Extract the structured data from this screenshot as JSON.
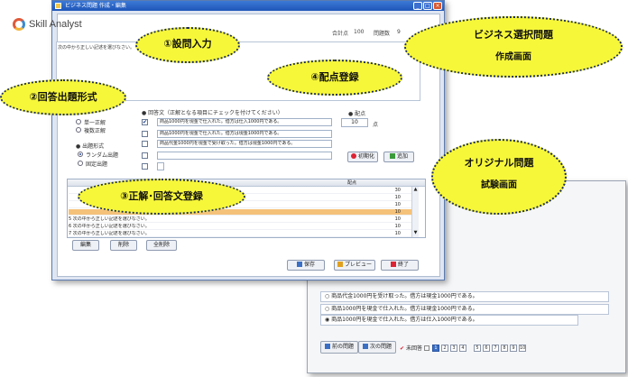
{
  "main_window": {
    "title": "ビジネス問題 作成・編集",
    "logo": "Skill Analyst",
    "total_points_label": "合計点",
    "total_points": "100",
    "question_count_label": "問題数",
    "question_count": "9",
    "question_text": "次の中から正しい記述を選びなさい。",
    "answer_section_label": "● 回答文（正解となる項目にチェックを付けてください）",
    "answer_format_options": [
      "単一正解",
      "複数正解"
    ],
    "question_format_label": "● 出題形式",
    "question_format_options": [
      "ランダム出題",
      "固定出題"
    ],
    "answers": [
      {
        "text": "商品1000円を現金で仕入れた。借方は仕入1000円である。",
        "checked": true
      },
      {
        "text": "商品1000円を現金で仕入れた。借方は現金1000円である。",
        "checked": false
      },
      {
        "text": "商品代金1000円を現金で受け取った。借方は現金1000円である。",
        "checked": false
      },
      {
        "text": "",
        "checked": false
      },
      {
        "text": "",
        "checked": false
      }
    ],
    "points_label": "● 配点",
    "points_value": "10",
    "points_unit": "点",
    "init_button": "初期化",
    "add_button": "追加",
    "list_header_points": "配点",
    "list_rows": [
      {
        "text": "",
        "points": "30"
      },
      {
        "text": "",
        "points": "10"
      },
      {
        "text": "",
        "points": "10"
      },
      {
        "text": "",
        "points": "10"
      },
      {
        "text": "5  次の中から正しい記述を選びなさい。",
        "points": "10"
      },
      {
        "text": "6  次の中から正しい記述を選びなさい。",
        "points": "10"
      },
      {
        "text": "7  次の中から正しい記述を選びなさい。",
        "points": "10"
      }
    ],
    "selected_row_index": 3,
    "edit_button": "編集",
    "delete_button": "削除",
    "delete_all_button": "全削除",
    "save_button": "保存",
    "preview_button": "プレビュー",
    "exit_button": "終了"
  },
  "back_window": {
    "options": [
      "商品代金1000円を受け取った。借方は現金1000円である。",
      "商品1000円を現金で仕入れた。借方は現金1000円である。",
      "商品1000円を現金で仕入れた。借方は仕入1000円である。"
    ],
    "prev_button": "前の問題",
    "next_button": "次の問題",
    "answered_label": "未回答",
    "pages": [
      "1",
      "2",
      "3",
      "4",
      "5",
      "6",
      "7",
      "8",
      "9",
      "10"
    ]
  },
  "callouts": {
    "c1": "①設問入力",
    "c2": "②回答出題形式",
    "c3": "③正解･回答文登録",
    "c4": "④配点登録",
    "c5_line1": "ビジネス選択問題",
    "c5_line2": "作成画面",
    "c6_line1": "オリジナル問題",
    "c6_line2": "試験画面"
  },
  "colors": {
    "callout_fill": "#f7f73a",
    "callout_border": "#1a2a66",
    "titlebar": "#1f56b8",
    "selected_row": "#f5c27a"
  }
}
